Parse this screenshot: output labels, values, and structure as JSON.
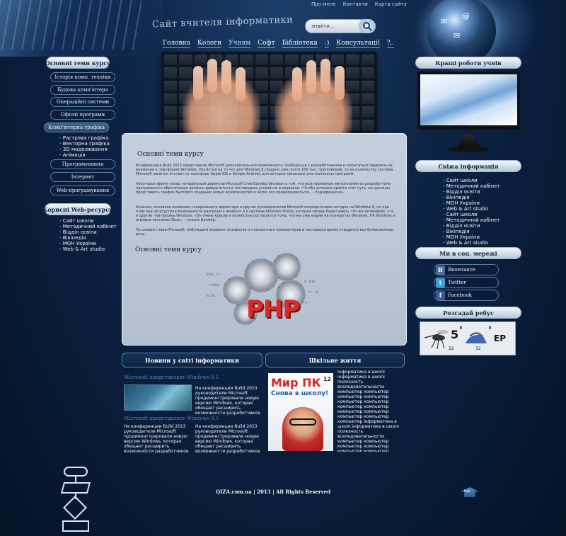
{
  "header": {
    "site_title": "Сайт вчителя інформатики",
    "top_links": [
      "Про мене",
      "Контакти",
      "Карта сайту"
    ],
    "search_placeholder": "знайти..."
  },
  "nav": {
    "items": [
      "Головна",
      "Колеги",
      "Учням",
      "Софт",
      "Бібліотека",
      ":)",
      "Консультації",
      "?.."
    ],
    "active_index": 2
  },
  "left": {
    "topics_head": "Основні теми курсу",
    "topics": [
      "Історія комп. техніки",
      "Будова комп'ютера",
      "Операційні системи",
      "Офісні програми",
      "Комп'ютерна графіка",
      "Програмування",
      "Інтернет",
      "Web-програмування"
    ],
    "active_topic_index": 4,
    "graphics_sub": [
      "Растрова графіка",
      "Векторна графіка",
      "3D моделювання",
      "Анімація"
    ],
    "resources_head": "Корисні Web-ресурси",
    "resources": [
      "Сайт школи",
      "Методичний кабінет",
      "Відділ освіти",
      "Вікіпедія",
      "МОН України",
      "Web & Art studio"
    ]
  },
  "main": {
    "heading1": "Основні теми курсу",
    "para1": "Конференция Build 2013 представила Microsoft дополнительную возможность пообщаться с разработчиками и попытаться привлечь их внимание к платформе Windows. Несмотря на то что для Windows 8 создано уже почти 100 тыс. приложений, по их количеству система Microsoft заметно отстает от платформ Apple iOS и Google Android, для которых написаны уже миллионы программ.",
    "para2": "Некоторое время назад генеральный директор Microsoft Стив Балмер объявил о том, что возглавляемая им компания из разработчика программного обеспечения должна превратиться в поставщика устройств и сервисов. «Чтобы успешно пройти этот путь, мы должны представить график быстрого создания новых возможностей и четко его придерживаться», – подчеркнул он.",
    "para3": "Конечно, основное внимание генерального директора и других руководителей Microsoft сосредоточено сегодня на Windows 8, но при этом они не упустили возможности рассказать немного и о системе Windows Phone, которая теперь будет иметь тот же интерфейс, что и другие платформы Windows. «Он очень красив и полностью согласуется тому, что мы уже видим на планшетах Windows, ПК Windows и игровых системах Xbox», – указал Балмер.",
    "para4": "По словам главы Microsoft, небольшим экранам телефонов и планшетных компьютеров в настоящее время отводится все более важная роль.",
    "heading2": "Основні теми курсу",
    "php_label": "PHP",
    "code_snippets": [
      "?php if",
      "<?php",
      "echo",
      "$ php",
      "if ($",
      "?>"
    ]
  },
  "right": {
    "best_works_head": "Кращі роботи учнів",
    "news_head": "Свіжа інформація",
    "news_links_1": [
      "Сайт школи",
      "Методичний кабінет",
      "Відділ освіти",
      "Вікіпедія",
      "МОН України",
      "Web & Art studio"
    ],
    "news_links_2": [
      "Сайт школи",
      "Методичний кабінет",
      "Відділ освіти",
      "Вікіпедія",
      "МОН України",
      "Web & Art studio"
    ],
    "social_head": "Ми в соц. мережі",
    "social": [
      {
        "label": "Вконтакте",
        "icon": "B",
        "color": "#4a6d99"
      },
      {
        "label": "Twitter",
        "icon": "t",
        "color": "#3aa0d8"
      },
      {
        "label": "Facebook",
        "icon": "f",
        "color": "#3b5a98"
      }
    ],
    "rebus_head": "Розгадай ребус",
    "rebus_text": "ЕР",
    "rebus_marks": [
      "5",
      "'",
      "'",
      "22",
      "32"
    ]
  },
  "bottom": {
    "news_panel_head": "Новини у світі інформатики",
    "news": [
      {
        "title": "Microsoft представляет Windows 8.1",
        "text": "На конференции Build 2013 руководители Microsoft продемонстрировали новую версию Windows, которая обещает расширить возможности разработчиков"
      },
      {
        "title": "Microsoft представляет Windows 8.1",
        "text": "На конференции Build 2013 руководители Microsoft продемонстрировали новую версию Windows, которая обещает расширить возможности разработчиков",
        "text2": "На конференции Build 2013 руководители Microsoft продемонстрировали новую версию Windows, которая обещает расширить возможности разработчиков"
      }
    ],
    "school_panel_head": "Шкільне життя",
    "magazine_title": "Мир ПК",
    "magazine_number": "12",
    "magazine_sub": "Снова в школу!",
    "school_text": "Інформатика в школі інформатика в школі полезность вселедовательности компьютер компьютер компьютер компьютер компьютер компьютер компьютер компьютер компьютер компьютер компьютер компьютер компьютер інформатика в школі інформатика в школі полезность вселедовательности компьютер компьютер компьютер компьютер компьютер компьютер компьютер компьютер компьютер компьютер компьютер компьютер компьютер компьютер інформатика в школі інформатика в школі полезность вселедовательности компьютер компьютер компьютер компьютер компьютер компьютер компьютер компьютер компьютер компьютер компьютер"
  },
  "footer": {
    "copyright": "QIZA.com.ua | 2013 | All Rights Reserved",
    "top_label": "top"
  }
}
